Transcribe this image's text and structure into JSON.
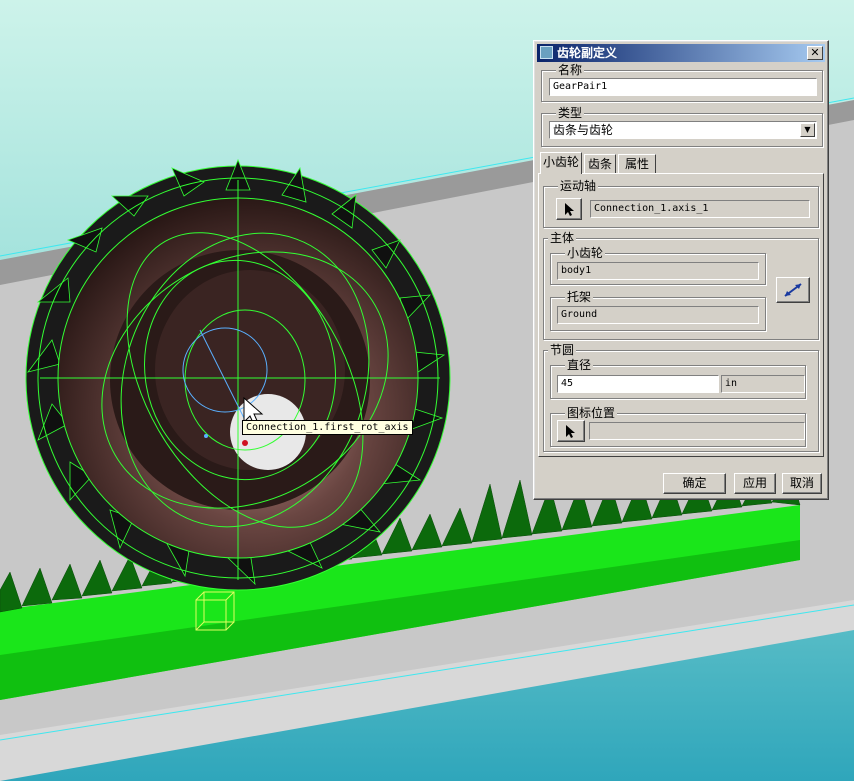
{
  "viewport": {
    "tooltip": "Connection_1.first_rot_axis"
  },
  "dialog": {
    "title": "齿轮副定义",
    "name_group": {
      "label": "名称",
      "value": "GearPair1"
    },
    "type_group": {
      "label": "类型",
      "selected": "齿条与齿轮"
    },
    "tabs": [
      {
        "label": "小齿轮",
        "active": true
      },
      {
        "label": "齿条",
        "active": false
      },
      {
        "label": "属性",
        "active": false
      }
    ],
    "motion_axis": {
      "label": "运动轴",
      "value": "Connection_1.axis_1"
    },
    "body": {
      "label": "主体",
      "pinion": {
        "label": "小齿轮",
        "value": "body1"
      },
      "carrier": {
        "label": "托架",
        "value": "Ground"
      }
    },
    "pitch_circle": {
      "label": "节圆",
      "diameter": {
        "label": "直径",
        "value": "45",
        "unit": "in"
      },
      "icon_position": {
        "label": "图标位置",
        "value": ""
      }
    },
    "buttons": {
      "ok": "确定",
      "apply": "应用",
      "cancel": "取消"
    }
  },
  "colors": {
    "viewport_top": "#cdf3ea",
    "viewport_bottom": "#2fa6bb",
    "rack": "#1ae61a",
    "wireframe": "#33ff33",
    "gear_body": "#5a3a36",
    "dialog_face": "#d4d0c8",
    "titlebar": "#0a246a"
  }
}
